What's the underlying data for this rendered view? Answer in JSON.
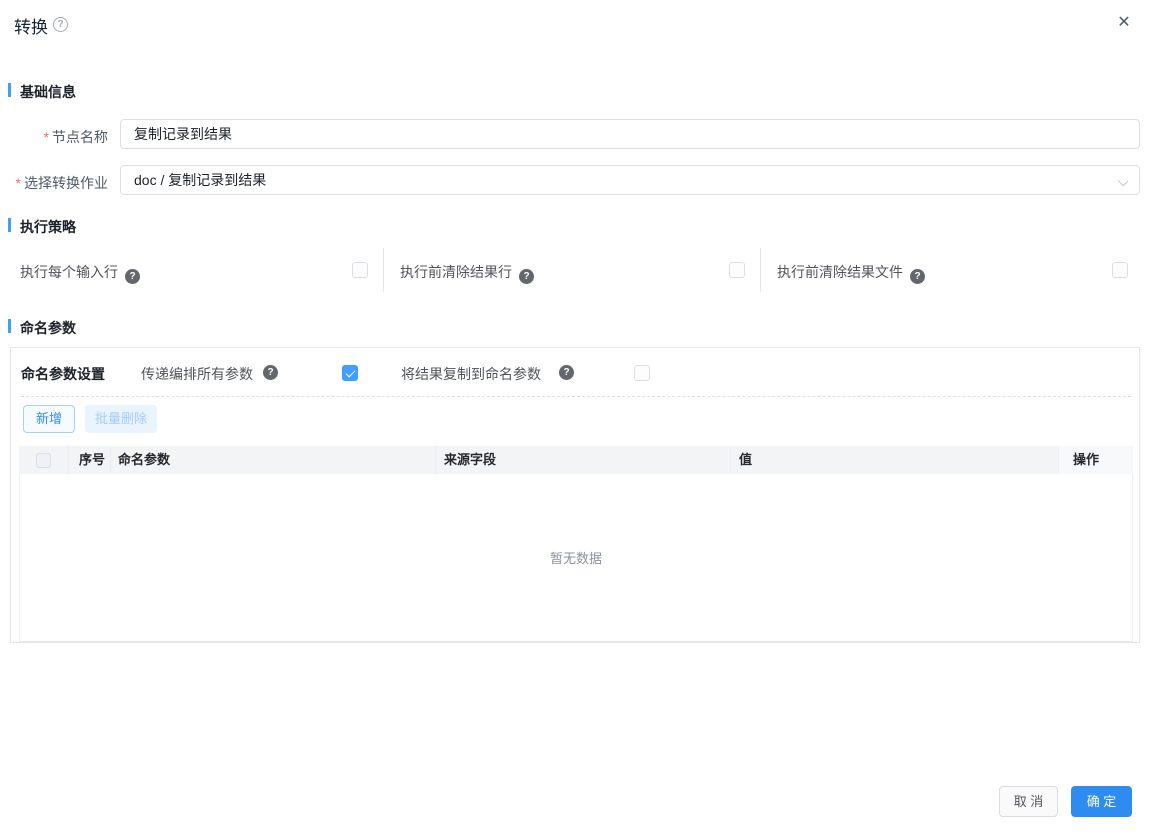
{
  "dialog": {
    "title": "转换",
    "close_icon": "✕",
    "help_icon": "?"
  },
  "sections": {
    "basic": "基础信息",
    "strategy": "执行策略",
    "params": "命名参数"
  },
  "form": {
    "required_mark": "*",
    "node_name": {
      "label": "节点名称",
      "value": "复制记录到结果"
    },
    "job": {
      "label": "选择转换作业",
      "value": "doc / 复制记录到结果"
    }
  },
  "strategy_options": [
    {
      "label": "执行每个输入行",
      "checked": false
    },
    {
      "label": "执行前清除结果行",
      "checked": false
    },
    {
      "label": "执行前清除结果文件",
      "checked": false
    }
  ],
  "params_panel": {
    "settings_label": "命名参数设置",
    "options": [
      {
        "label": "传递编排所有参数",
        "checked": true
      },
      {
        "label": "将结果复制到命名参数",
        "checked": false
      }
    ],
    "add_button": "新增",
    "batch_delete_button": "批量删除",
    "table": {
      "columns": [
        "序号",
        "命名参数",
        "来源字段",
        "值",
        "操作"
      ],
      "rows": [],
      "empty_text": "暂无数据"
    }
  },
  "footer": {
    "cancel": "取 消",
    "confirm": "确 定"
  },
  "colors": {
    "accent": "#409eff",
    "confirm_button": "#2e8bf0",
    "required": "#f56c6c"
  }
}
